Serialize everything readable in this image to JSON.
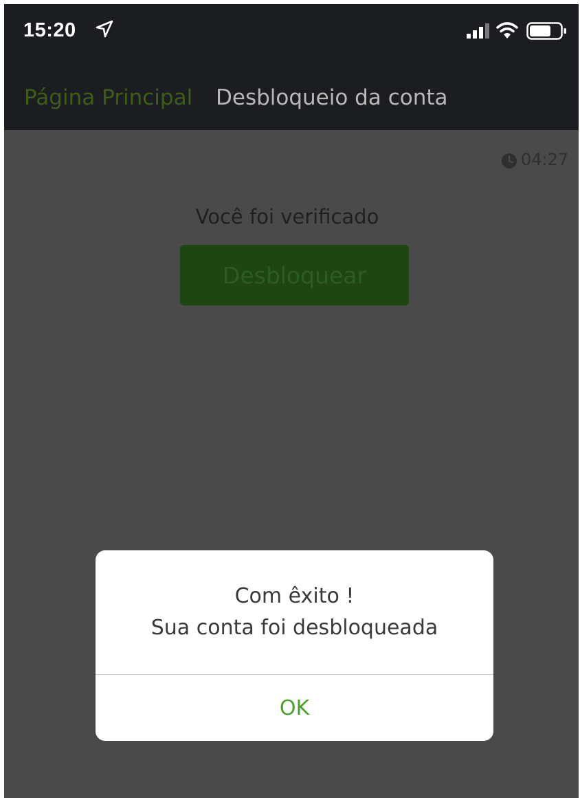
{
  "status_bar": {
    "time": "15:20",
    "icons": [
      "location-arrow-icon",
      "signal-icon",
      "wifi-icon",
      "battery-icon"
    ]
  },
  "nav": {
    "home_link": "Página Principal",
    "title": "Desbloqueio da conta"
  },
  "main": {
    "timer": "04:27",
    "verified_text": "Você foi verificado",
    "unlock_button": "Desbloquear"
  },
  "dialog": {
    "line1": "Com êxito !",
    "line2": "Sua conta foi desbloqueada",
    "ok_label": "OK"
  },
  "colors": {
    "bar_background": "#1b1d20",
    "overlay_background": "#4a4a4a",
    "accent_green": "#4aa02c",
    "button_dimmed": "#1e4512"
  }
}
